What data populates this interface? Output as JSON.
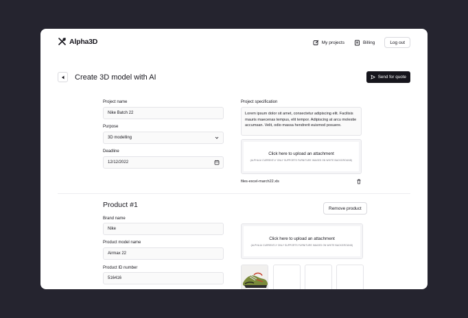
{
  "brand": {
    "name": "Alpha3D",
    "logo_icon": "alpha3d-logo-icon"
  },
  "nav": {
    "my_projects": "My projects",
    "billing": "Billing",
    "logout": "Log out"
  },
  "page": {
    "title": "Create 3D model with AI",
    "send_button": "Send for quote"
  },
  "project": {
    "name_label": "Project name",
    "name_value": "Nike Batch 22",
    "purpose_label": "Purpose",
    "purpose_value": "3D modelling",
    "deadline_label": "Deadline",
    "deadline_value": "12/12/2022",
    "spec_label": "Project specification",
    "spec_value": "Lorem ipsum dolor sit amet, consectetur adipiscing elit. Facilisis mauris maecenas tempus, elit tempor. Adipiscing at arcu molestie accumsan. Velit, odio massa hendrerit euismod posuere.",
    "upload_title": "Click here to upload an attachment",
    "upload_hint": "(ALPHA AI CURRENTLY ONLY SUPPORTS FURNITURE IMAGES ON WHITE BACKGROUND)",
    "attachment_name": "files-excel-march22.xls"
  },
  "product": {
    "title": "Product #1",
    "remove_button": "Remove product",
    "brand_label": "Brand name",
    "brand_value": "Nike",
    "model_label": "Product model name",
    "model_value": "Airmax 22",
    "id_label": "Product ID number",
    "id_value": "516416",
    "upload_title": "Click here to upload an attachment",
    "upload_hint": "(ALPHA AI CURRENTLY ONLY SUPPORTS FURNITURE IMAGES ON WHITE BACKGROUND)"
  },
  "colors": {
    "background": "#25242f",
    "primary": "#16151c",
    "card": "#ffffff"
  }
}
